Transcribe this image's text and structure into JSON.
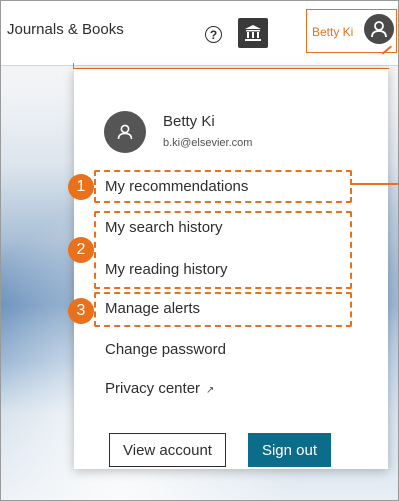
{
  "header": {
    "nav_link": "Journals & Books",
    "help_icon": "help-icon",
    "institution_icon": "institution-icon",
    "account_name": "Betty Ki",
    "account_avatar_icon": "user-icon"
  },
  "dropdown": {
    "user_name": "Betty Ki",
    "user_email": "b.ki@elsevier.com",
    "items": [
      {
        "label": "My recommendations"
      },
      {
        "label": "My search history"
      },
      {
        "label": "My reading history"
      },
      {
        "label": "Manage alerts"
      },
      {
        "label": "Change password"
      },
      {
        "label": "Privacy center",
        "external": "↗"
      }
    ],
    "view_account": "View account",
    "sign_out": "Sign out"
  },
  "callouts": [
    "1",
    "2",
    "3"
  ],
  "colors": {
    "accent": "#e9711c",
    "primary_button": "#0c6d8b",
    "text": "#2e2e2e"
  }
}
